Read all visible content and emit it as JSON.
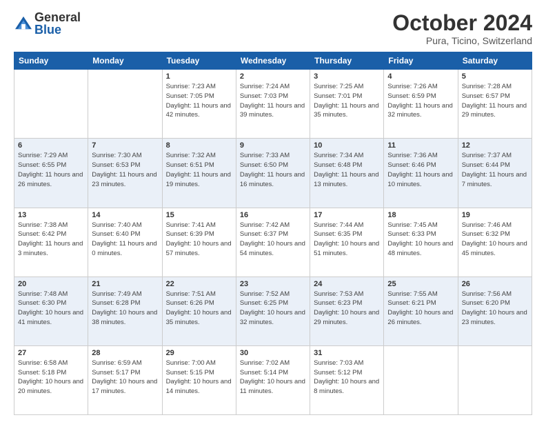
{
  "header": {
    "logo_line1": "General",
    "logo_line2": "Blue",
    "month": "October 2024",
    "location": "Pura, Ticino, Switzerland"
  },
  "days_of_week": [
    "Sunday",
    "Monday",
    "Tuesday",
    "Wednesday",
    "Thursday",
    "Friday",
    "Saturday"
  ],
  "weeks": [
    [
      {
        "day": "",
        "sunrise": "",
        "sunset": "",
        "daylight": ""
      },
      {
        "day": "",
        "sunrise": "",
        "sunset": "",
        "daylight": ""
      },
      {
        "day": "1",
        "sunrise": "Sunrise: 7:23 AM",
        "sunset": "Sunset: 7:05 PM",
        "daylight": "Daylight: 11 hours and 42 minutes."
      },
      {
        "day": "2",
        "sunrise": "Sunrise: 7:24 AM",
        "sunset": "Sunset: 7:03 PM",
        "daylight": "Daylight: 11 hours and 39 minutes."
      },
      {
        "day": "3",
        "sunrise": "Sunrise: 7:25 AM",
        "sunset": "Sunset: 7:01 PM",
        "daylight": "Daylight: 11 hours and 35 minutes."
      },
      {
        "day": "4",
        "sunrise": "Sunrise: 7:26 AM",
        "sunset": "Sunset: 6:59 PM",
        "daylight": "Daylight: 11 hours and 32 minutes."
      },
      {
        "day": "5",
        "sunrise": "Sunrise: 7:28 AM",
        "sunset": "Sunset: 6:57 PM",
        "daylight": "Daylight: 11 hours and 29 minutes."
      }
    ],
    [
      {
        "day": "6",
        "sunrise": "Sunrise: 7:29 AM",
        "sunset": "Sunset: 6:55 PM",
        "daylight": "Daylight: 11 hours and 26 minutes."
      },
      {
        "day": "7",
        "sunrise": "Sunrise: 7:30 AM",
        "sunset": "Sunset: 6:53 PM",
        "daylight": "Daylight: 11 hours and 23 minutes."
      },
      {
        "day": "8",
        "sunrise": "Sunrise: 7:32 AM",
        "sunset": "Sunset: 6:51 PM",
        "daylight": "Daylight: 11 hours and 19 minutes."
      },
      {
        "day": "9",
        "sunrise": "Sunrise: 7:33 AM",
        "sunset": "Sunset: 6:50 PM",
        "daylight": "Daylight: 11 hours and 16 minutes."
      },
      {
        "day": "10",
        "sunrise": "Sunrise: 7:34 AM",
        "sunset": "Sunset: 6:48 PM",
        "daylight": "Daylight: 11 hours and 13 minutes."
      },
      {
        "day": "11",
        "sunrise": "Sunrise: 7:36 AM",
        "sunset": "Sunset: 6:46 PM",
        "daylight": "Daylight: 11 hours and 10 minutes."
      },
      {
        "day": "12",
        "sunrise": "Sunrise: 7:37 AM",
        "sunset": "Sunset: 6:44 PM",
        "daylight": "Daylight: 11 hours and 7 minutes."
      }
    ],
    [
      {
        "day": "13",
        "sunrise": "Sunrise: 7:38 AM",
        "sunset": "Sunset: 6:42 PM",
        "daylight": "Daylight: 11 hours and 3 minutes."
      },
      {
        "day": "14",
        "sunrise": "Sunrise: 7:40 AM",
        "sunset": "Sunset: 6:40 PM",
        "daylight": "Daylight: 11 hours and 0 minutes."
      },
      {
        "day": "15",
        "sunrise": "Sunrise: 7:41 AM",
        "sunset": "Sunset: 6:39 PM",
        "daylight": "Daylight: 10 hours and 57 minutes."
      },
      {
        "day": "16",
        "sunrise": "Sunrise: 7:42 AM",
        "sunset": "Sunset: 6:37 PM",
        "daylight": "Daylight: 10 hours and 54 minutes."
      },
      {
        "day": "17",
        "sunrise": "Sunrise: 7:44 AM",
        "sunset": "Sunset: 6:35 PM",
        "daylight": "Daylight: 10 hours and 51 minutes."
      },
      {
        "day": "18",
        "sunrise": "Sunrise: 7:45 AM",
        "sunset": "Sunset: 6:33 PM",
        "daylight": "Daylight: 10 hours and 48 minutes."
      },
      {
        "day": "19",
        "sunrise": "Sunrise: 7:46 AM",
        "sunset": "Sunset: 6:32 PM",
        "daylight": "Daylight: 10 hours and 45 minutes."
      }
    ],
    [
      {
        "day": "20",
        "sunrise": "Sunrise: 7:48 AM",
        "sunset": "Sunset: 6:30 PM",
        "daylight": "Daylight: 10 hours and 41 minutes."
      },
      {
        "day": "21",
        "sunrise": "Sunrise: 7:49 AM",
        "sunset": "Sunset: 6:28 PM",
        "daylight": "Daylight: 10 hours and 38 minutes."
      },
      {
        "day": "22",
        "sunrise": "Sunrise: 7:51 AM",
        "sunset": "Sunset: 6:26 PM",
        "daylight": "Daylight: 10 hours and 35 minutes."
      },
      {
        "day": "23",
        "sunrise": "Sunrise: 7:52 AM",
        "sunset": "Sunset: 6:25 PM",
        "daylight": "Daylight: 10 hours and 32 minutes."
      },
      {
        "day": "24",
        "sunrise": "Sunrise: 7:53 AM",
        "sunset": "Sunset: 6:23 PM",
        "daylight": "Daylight: 10 hours and 29 minutes."
      },
      {
        "day": "25",
        "sunrise": "Sunrise: 7:55 AM",
        "sunset": "Sunset: 6:21 PM",
        "daylight": "Daylight: 10 hours and 26 minutes."
      },
      {
        "day": "26",
        "sunrise": "Sunrise: 7:56 AM",
        "sunset": "Sunset: 6:20 PM",
        "daylight": "Daylight: 10 hours and 23 minutes."
      }
    ],
    [
      {
        "day": "27",
        "sunrise": "Sunrise: 6:58 AM",
        "sunset": "Sunset: 5:18 PM",
        "daylight": "Daylight: 10 hours and 20 minutes."
      },
      {
        "day": "28",
        "sunrise": "Sunrise: 6:59 AM",
        "sunset": "Sunset: 5:17 PM",
        "daylight": "Daylight: 10 hours and 17 minutes."
      },
      {
        "day": "29",
        "sunrise": "Sunrise: 7:00 AM",
        "sunset": "Sunset: 5:15 PM",
        "daylight": "Daylight: 10 hours and 14 minutes."
      },
      {
        "day": "30",
        "sunrise": "Sunrise: 7:02 AM",
        "sunset": "Sunset: 5:14 PM",
        "daylight": "Daylight: 10 hours and 11 minutes."
      },
      {
        "day": "31",
        "sunrise": "Sunrise: 7:03 AM",
        "sunset": "Sunset: 5:12 PM",
        "daylight": "Daylight: 10 hours and 8 minutes."
      },
      {
        "day": "",
        "sunrise": "",
        "sunset": "",
        "daylight": ""
      },
      {
        "day": "",
        "sunrise": "",
        "sunset": "",
        "daylight": ""
      }
    ]
  ]
}
